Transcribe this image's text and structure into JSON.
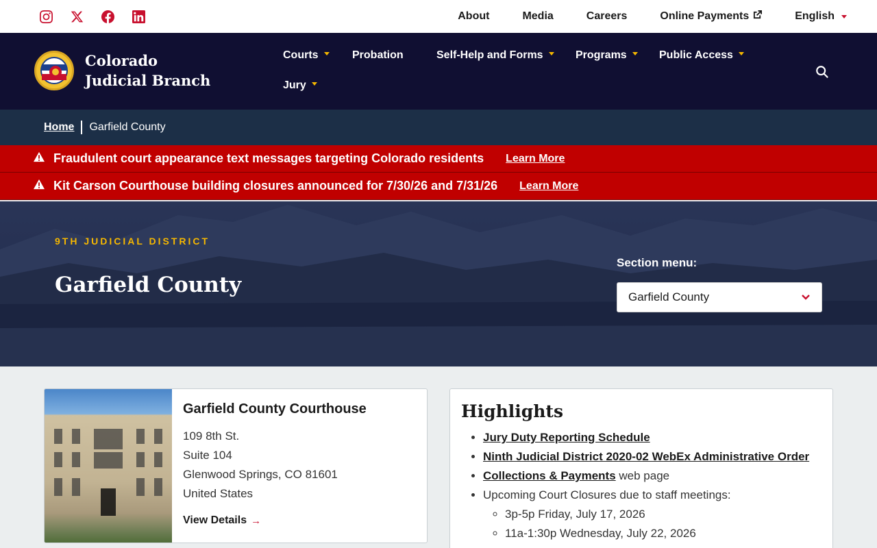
{
  "utility": {
    "social": [
      {
        "icon": "instagram-icon"
      },
      {
        "icon": "x-twitter-icon"
      },
      {
        "icon": "facebook-icon"
      },
      {
        "icon": "linkedin-icon"
      }
    ],
    "links": {
      "about": "About",
      "media": "Media",
      "careers": "Careers",
      "payments": "Online Payments",
      "language": "English"
    }
  },
  "header": {
    "logo_text": "Colorado Judicial Branch",
    "nav": {
      "courts": "Courts",
      "probation": "Probation",
      "selfhelp": "Self-Help and Forms",
      "programs": "Programs",
      "public_access": "Public Access",
      "jury": "Jury"
    }
  },
  "breadcrumb": {
    "home": "Home",
    "current": "Garfield County"
  },
  "alerts": [
    {
      "message": "Fraudulent court appearance text messages targeting Colorado residents",
      "link": "Learn More"
    },
    {
      "message": "Kit Carson Courthouse building closures announced for 7/30/26 and 7/31/26",
      "link": "Learn More"
    }
  ],
  "hero": {
    "district": "9TH JUDICIAL DISTRICT",
    "title": "Garfield County",
    "section_menu_label": "Section menu:",
    "section_menu_value": "Garfield County"
  },
  "courthouse": {
    "title": "Garfield County Courthouse",
    "address": [
      "109 8th St.",
      "Suite 104",
      "Glenwood Springs, CO 81601",
      "United States"
    ],
    "view_details": "View Details"
  },
  "highlights": {
    "title": "Highlights",
    "items": {
      "jury": "Jury Duty Reporting Schedule",
      "webex": "Ninth Judicial District 2020-02 WebEx Administrative Order",
      "collections_link": "Collections & Payments",
      "collections_suffix": " web page",
      "closures": "Upcoming Court Closures due to staff meetings:",
      "closure_1": "3p-5p Friday, July 17, 2026",
      "closure_2": "11a-1:30p Wednesday, July 22, 2026"
    }
  },
  "colors": {
    "accent_red": "#c8102e",
    "navy": "#100f32",
    "gold": "#f5b700",
    "alert_red": "#c00000"
  }
}
